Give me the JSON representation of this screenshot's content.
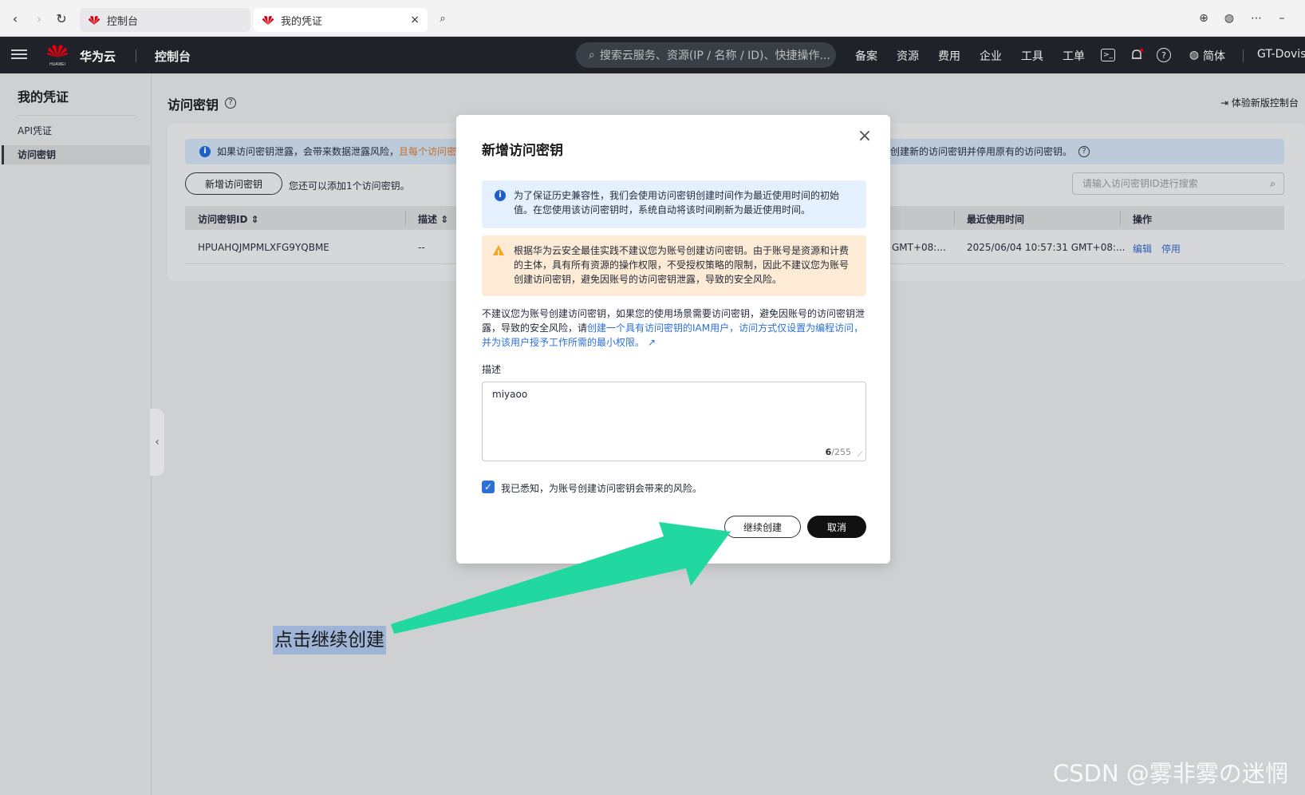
{
  "browser": {
    "tabs": [
      {
        "label": "控制台"
      },
      {
        "label": "我的凭证",
        "close": "×"
      }
    ]
  },
  "header": {
    "brand": "华为云",
    "logo_text": "HUAWEI",
    "console": "控制台",
    "search_placeholder": "搜索云服务、资源(IP / 名称 / ID)、快捷操作...",
    "nav": [
      "备案",
      "资源",
      "费用",
      "企业",
      "工具",
      "工单"
    ],
    "language": "简体",
    "user": "GT-Dovis"
  },
  "sidebar": {
    "title": "我的凭证",
    "items": [
      {
        "label": "API凭证",
        "active": false
      },
      {
        "label": "访问密钥",
        "active": true
      }
    ]
  },
  "main": {
    "title": "访问密钥",
    "new_console": "体验新版控制台",
    "alert_left": "如果访问密钥泄露，会带来数据泄露风险，",
    "alert_left_orange": "且每个访问密",
    "alert_right": "创建新的访问密钥并停用原有的访问密钥。",
    "add_button": "新增访问密钥",
    "quota": "您还可以添加1个访问密钥。",
    "search_placeholder": "请输入访问密钥ID进行搜索",
    "columns": {
      "id": "访问密钥ID",
      "desc": "描述",
      "last_used": "最近使用时间",
      "actions": "操作"
    },
    "row": {
      "id": "HPUAHQJMPMLXFG9YQBME",
      "desc": "--",
      "created_partial": "GMT+08:...",
      "last_used": "2025/06/04 10:57:31 GMT+08:...",
      "edit": "编辑",
      "disable": "停用"
    }
  },
  "dialog": {
    "title": "新增访问密钥",
    "info_notice": "为了保证历史兼容性，我们会使用访问密钥创建时间作为最近使用时间的初始值。在您使用该访问密钥时，系统自动将该时间刷新为最近使用时间。",
    "warning_notice": "根据华为云安全最佳实践不建议您为账号创建访问密钥。由于账号是资源和计费的主体，具有所有资源的操作权限，不受授权策略的限制，因此不建议您为账号创建访问密钥，避免因账号的访问密钥泄露，导致的安全风险。",
    "para_text": "不建议您为账号创建访问密钥，如果您的使用场景需要访问密钥，避免因账号的访问密钥泄露，导致的安全风险，请",
    "para_link": "创建一个具有访问密钥的IAM用户，访问方式仅设置为编程访问，并为该用户授予工作所需的最小权限。",
    "desc_label": "描述",
    "desc_value": "miyaoo",
    "count_current": "6",
    "count_max": "/255",
    "ack_label": "我已悉知，为账号创建访问密钥会带来的风险。",
    "continue_button": "继续创建",
    "cancel_button": "取消"
  },
  "annotation": {
    "text": "点击继续创建",
    "arrow_color": "#21d8a0"
  },
  "watermark": "CSDN @雾非雾の迷惘",
  "colors": {
    "header_bg": "#1f2329",
    "link": "#2d6fd9",
    "warning": "#f5a623",
    "info": "#1f5fc5"
  }
}
